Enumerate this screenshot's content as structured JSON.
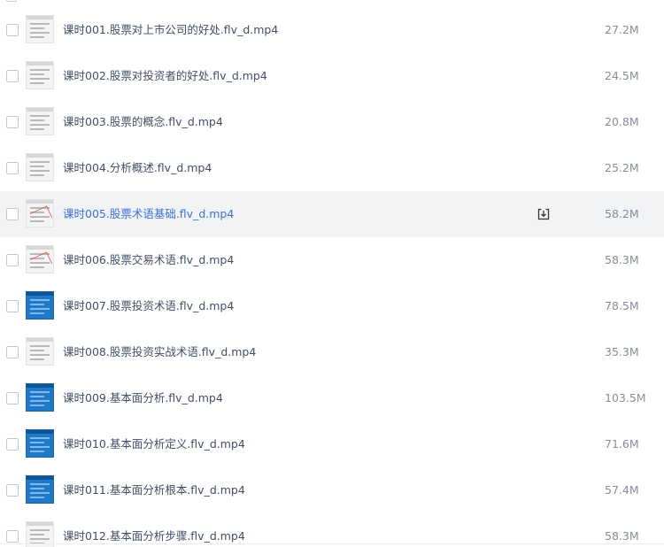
{
  "files": [
    {
      "name": "课时001.股票对上市公司的好处.flv_d.mp4",
      "size": "27.2M",
      "thumb": "doc"
    },
    {
      "name": "课时002.股票对投资者的好处.flv_d.mp4",
      "size": "24.5M",
      "thumb": "doc"
    },
    {
      "name": "课时003.股票的概念.flv_d.mp4",
      "size": "20.8M",
      "thumb": "doc"
    },
    {
      "name": "课时004.分析概述.flv_d.mp4",
      "size": "25.2M",
      "thumb": "doc"
    },
    {
      "name": "课时005.股票术语基础.flv_d.mp4",
      "size": "58.2M",
      "thumb": "doc-marked",
      "hovered": true
    },
    {
      "name": "课时006.股票交易术语.flv_d.mp4",
      "size": "58.3M",
      "thumb": "doc-marked"
    },
    {
      "name": "课时007.股票投资术语.flv_d.mp4",
      "size": "78.5M",
      "thumb": "blue"
    },
    {
      "name": "课时008.股票投资实战术语.flv_d.mp4",
      "size": "35.3M",
      "thumb": "doc"
    },
    {
      "name": "课时009.基本面分析.flv_d.mp4",
      "size": "103.5M",
      "thumb": "blue"
    },
    {
      "name": "课时010.基本面分析定义.flv_d.mp4",
      "size": "71.6M",
      "thumb": "blue"
    },
    {
      "name": "课时011.基本面分析根本.flv_d.mp4",
      "size": "57.4M",
      "thumb": "blue"
    },
    {
      "name": "课时012.基本面分析步骤.flv_d.mp4",
      "size": "58.3M",
      "thumb": "doc"
    }
  ],
  "icons": {
    "download": "download-icon"
  },
  "colors": {
    "hover_row_bg": "#f2f3f5",
    "hover_text": "#3b6fd6",
    "name_text": "#424e67",
    "size_text": "#878c9c"
  }
}
